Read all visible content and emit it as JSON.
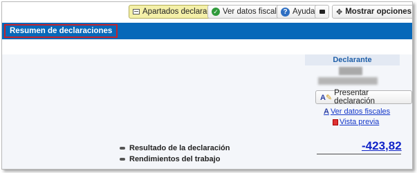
{
  "toolbar": {
    "apartados_label": "Apartados declaración",
    "ver_datos_label": "Ver datos fiscales",
    "ayuda_label": "Ayuda",
    "mostrar_label": "Mostrar opciones"
  },
  "header": {
    "title": "Resumen de declaraciones"
  },
  "declarante": {
    "heading": "Declarante",
    "presentar_label": "Presentar declaración",
    "ver_datos_link": "Ver datos fiscales",
    "vista_previa_link": "Vista previa"
  },
  "resumen": {
    "resultado_label": "Resultado de la declaración",
    "resultado_value": "-423,82",
    "rendimientos_label": "Rendimientos del trabajo"
  },
  "colors": {
    "accent_blue": "#0768b9",
    "highlight_border": "#c4232b",
    "active_button": "#f4f0a8",
    "link": "#1336c9"
  }
}
